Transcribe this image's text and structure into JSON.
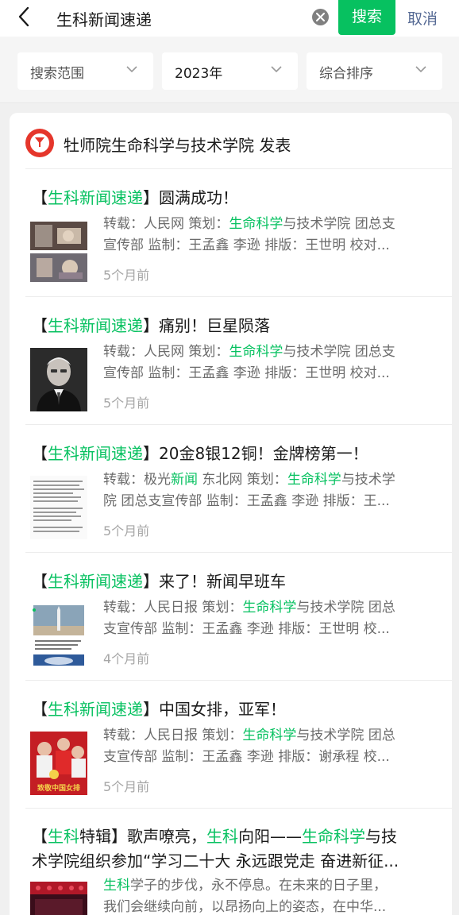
{
  "search": {
    "query": "生科新闻速递",
    "search_label": "搜索",
    "cancel_label": "取消"
  },
  "filters": [
    {
      "label": "搜索范围"
    },
    {
      "label": "2023年"
    },
    {
      "label": "综合排序"
    }
  ],
  "account": {
    "name": "牡师院生命科学与技术学院 发表"
  },
  "results": [
    {
      "title": {
        "open": "【",
        "tag": "生科新闻速递",
        "close": "】",
        "rest": "圆满成功！"
      },
      "desc": [
        [
          {
            "t": "转载：人民网 策划："
          },
          {
            "t": "生命科学",
            "hl": true
          },
          {
            "t": "与技术学院 团总支"
          }
        ],
        [
          {
            "t": "宣传部 监制：王孟鑫 李逊 排版：王世明 校对..."
          }
        ]
      ],
      "time": "5个月前",
      "thumb_icon": "space-station-image"
    },
    {
      "title": {
        "open": "【",
        "tag": "生科新闻速递",
        "close": "】",
        "rest": "痛别！巨星陨落"
      },
      "desc": [
        [
          {
            "t": "转载：人民网 策划："
          },
          {
            "t": "生命科学",
            "hl": true
          },
          {
            "t": "与技术学院 团总支"
          }
        ],
        [
          {
            "t": "宣传部 监制：王孟鑫 李逊 排版：王世明 校对..."
          }
        ]
      ],
      "time": "5个月前",
      "thumb_icon": "portrait-image"
    },
    {
      "title": {
        "open": "【",
        "tag": "生科新闻速递",
        "close": "】",
        "rest": "20金8银12铜！金牌榜第一！"
      },
      "desc": [
        [
          {
            "t": "转载：极光"
          },
          {
            "t": "新闻",
            "hl": true
          },
          {
            "t": " 东北网 策划："
          },
          {
            "t": "生命科学",
            "hl": true
          },
          {
            "t": "与技术学"
          }
        ],
        [
          {
            "t": "院 团总支宣传部 监制：王孟鑫 李逊 排版：王..."
          }
        ]
      ],
      "time": "5个月前",
      "thumb_icon": "article-text-image"
    },
    {
      "title": {
        "open": "【",
        "tag": "生科新闻速递",
        "close": "】",
        "rest": "来了！新闻早班车"
      },
      "desc": [
        [
          {
            "t": "转载：人民日报 策划："
          },
          {
            "t": "生命科学",
            "hl": true
          },
          {
            "t": "与技术学院 团总"
          }
        ],
        [
          {
            "t": "支宣传部 监制：王孟鑫 李逊 排版：王世明 校..."
          }
        ]
      ],
      "time": "4个月前",
      "thumb_icon": "rocket-launch-image"
    },
    {
      "title": {
        "open": "【",
        "tag": "生科新闻速递",
        "close": "】",
        "rest": "中国女排，亚军！"
      },
      "desc": [
        [
          {
            "t": "转载：人民日报 策划："
          },
          {
            "t": "生命科学",
            "hl": true
          },
          {
            "t": "与技术学院 团总"
          }
        ],
        [
          {
            "t": "支宣传部 监制：王孟鑫 李逊 排版：谢承程 校..."
          }
        ]
      ],
      "time": "5个月前",
      "thumb_icon": "volleyball-poster-image",
      "thumb_caption": "致敬中国女排"
    },
    {
      "title_lines": [
        [
          {
            "t": "【"
          },
          {
            "t": "生科",
            "hl": true
          },
          {
            "t": "特辑】歌声嘹亮，"
          },
          {
            "t": "生科",
            "hl": true
          },
          {
            "t": "向阳——"
          },
          {
            "t": "生命科学",
            "hl": true
          },
          {
            "t": "与技"
          }
        ],
        [
          {
            "t": "术学院组织参加“学习二十大 永远跟党走 奋进新征..."
          }
        ]
      ],
      "desc": [
        [
          {
            "t": "生科",
            "hl": true
          },
          {
            "t": "学子的步伐，永不停息。在未来的日子里，"
          }
        ],
        [
          {
            "t": "我们会继续向前，以昂扬向上的姿态，在中华..."
          }
        ]
      ],
      "thumb_icon": "stage-performance-image"
    }
  ],
  "colors": {
    "accent": "#07c160",
    "link": "#576b95",
    "secondary_text": "#6b6b6b",
    "time_text": "#a6a6a6"
  }
}
